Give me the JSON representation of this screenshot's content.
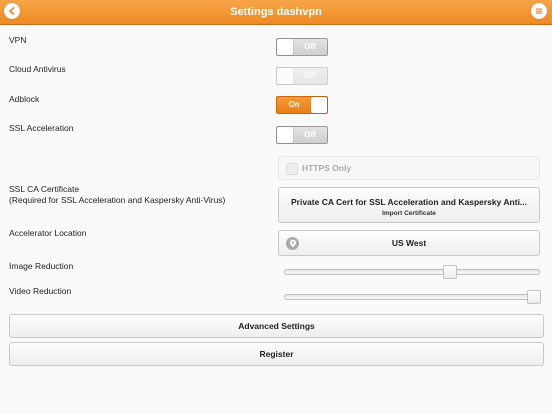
{
  "header": {
    "title": "Settings dashvpn",
    "back_icon": "back-arrow-icon",
    "menu_icon": "menu-icon"
  },
  "settings": {
    "vpn": {
      "label": "VPN",
      "state": "Off"
    },
    "cloud_antivirus": {
      "label": "Cloud Antivirus",
      "state": "Off",
      "disabled": true
    },
    "adblock": {
      "label": "Adblock",
      "state": "On"
    },
    "ssl_acceleration": {
      "label": "SSL Acceleration",
      "state": "Off"
    },
    "https_only": {
      "label": "HTTPS Only",
      "checked": false,
      "disabled": true
    },
    "ssl_ca_certificate": {
      "label": "SSL CA Certificate",
      "sublabel": "(Required for SSL Acceleration and Kaspersky Anti-Virus)",
      "button_title": "Private CA Cert for SSL Acceleration and Kaspersky Anti...",
      "button_subtitle": "Import Certificate"
    },
    "accelerator_location": {
      "label": "Accelerator Location",
      "value": "US West",
      "icon": "location-pin-icon"
    },
    "image_reduction": {
      "label": "Image Reduction",
      "level_fraction": 0.65
    },
    "video_reduction": {
      "label": "Video Reduction",
      "level_fraction": 0.98
    }
  },
  "buttons": {
    "advanced": "Advanced Settings",
    "register": "Register"
  },
  "colors": {
    "accent": "#f08e2a"
  }
}
